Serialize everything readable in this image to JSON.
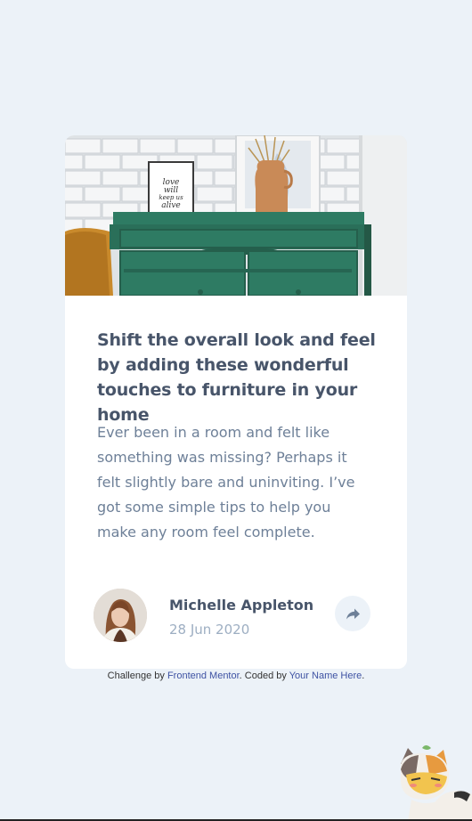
{
  "card": {
    "title": "Shift the overall look and feel by adding these wonderful touches to furniture in your home",
    "description": "Ever been in a room and felt like something was missing? Perhaps it felt slightly bare and uninviting. I’ve got some simple tips to help you make any room feel complete.",
    "hero_image_icon": "drawers-photo",
    "frame_text": [
      "love",
      "will",
      "keep us",
      "alive"
    ]
  },
  "author": {
    "name": "Michelle Appleton",
    "date": "28 Jun 2020",
    "avatar_icon": "avatar-photo"
  },
  "share": {
    "icon": "share-icon"
  },
  "attribution": {
    "prefix": "Challenge by ",
    "link1": "Frontend Mentor",
    "middle": ". Coded by ",
    "link2": "Your Name Here",
    "suffix": "."
  },
  "colors": {
    "background": "#ecf2f8",
    "card": "#ffffff",
    "title": "#48556a",
    "body": "#6e8098",
    "date": "#9daec2",
    "link": "#3e52a3",
    "drawer": "#2e7b63"
  }
}
